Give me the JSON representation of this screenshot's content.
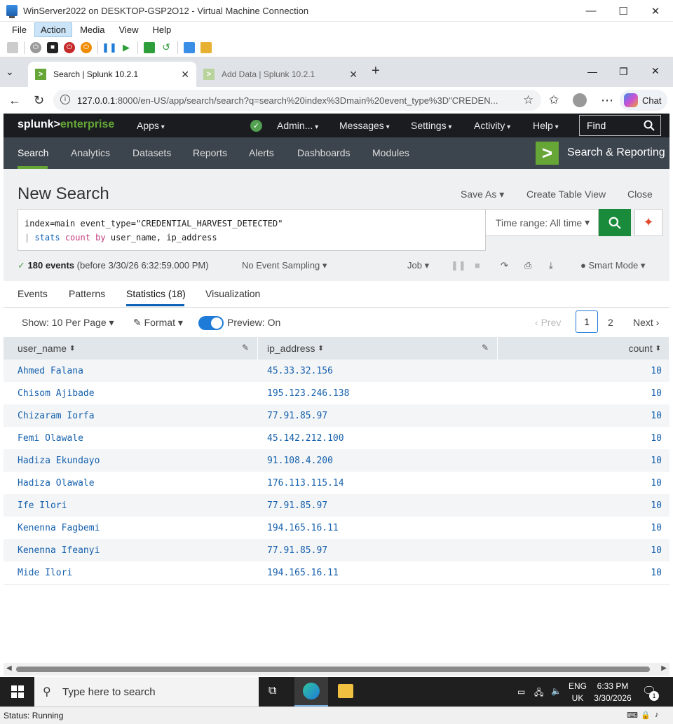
{
  "vm": {
    "title": "WinServer2022 on DESKTOP-GSP2O12 - Virtual Machine Connection",
    "menu": [
      "File",
      "Action",
      "Media",
      "View",
      "Help"
    ],
    "status": "Status: Running"
  },
  "browser": {
    "tabs": [
      {
        "label": "Search | Splunk 10.2.1",
        "active": true
      },
      {
        "label": "Add Data | Splunk 10.2.1",
        "active": false
      }
    ],
    "url_host": "127.0.0.1",
    "url_rest": ":8000/en-US/app/search/search?q=search%20index%3Dmain%20event_type%3D\"CREDEN...",
    "chat_label": "Chat"
  },
  "splunk": {
    "logo_a": "splunk>",
    "logo_b": "enterprise",
    "top_menu": {
      "apps": "Apps",
      "admin": "Admin...",
      "messages": "Messages",
      "settings": "Settings",
      "activity": "Activity",
      "help": "Help"
    },
    "find_placeholder": "Find",
    "nav": [
      "Search",
      "Analytics",
      "Datasets",
      "Reports",
      "Alerts",
      "Dashboards",
      "Modules"
    ],
    "app_name": "Search & Reporting"
  },
  "search": {
    "title": "New Search",
    "save_as": "Save As",
    "create_table_view": "Create Table View",
    "close": "Close",
    "query_line1": "index=main event_type=\"CREDENTIAL_HARVEST_DETECTED\"",
    "query_pipe": "| ",
    "query_cmd": "stats",
    "query_fn": "count",
    "query_by": "by",
    "query_fields": "user_name, ip_address",
    "time_range": "Time range: All time",
    "events_count": "180 events",
    "events_before": "(before 3/30/26 6:32:59.000 PM)",
    "sampling": "No Event Sampling",
    "job": "Job",
    "mode": "Smart Mode"
  },
  "result_tabs": [
    "Events",
    "Patterns",
    "Statistics (18)",
    "Visualization"
  ],
  "controls": {
    "show": "Show: 10 Per Page",
    "format": "Format",
    "preview": "Preview: On",
    "prev": "Prev",
    "page1": "1",
    "page2": "2",
    "next": "Next"
  },
  "table": {
    "columns": [
      "user_name",
      "ip_address",
      "count"
    ],
    "rows": [
      [
        "Ahmed Falana",
        "45.33.32.156",
        "10"
      ],
      [
        "Chisom Ajibade",
        "195.123.246.138",
        "10"
      ],
      [
        "Chizaram Iorfa",
        "77.91.85.97",
        "10"
      ],
      [
        "Femi Olawale",
        "45.142.212.100",
        "10"
      ],
      [
        "Hadiza Ekundayo",
        "91.108.4.200",
        "10"
      ],
      [
        "Hadiza Olawale",
        "176.113.115.14",
        "10"
      ],
      [
        "Ife Ilori",
        "77.91.85.97",
        "10"
      ],
      [
        "Kenenna Fagbemi",
        "194.165.16.11",
        "10"
      ],
      [
        "Kenenna Ifeanyi",
        "77.91.85.97",
        "10"
      ],
      [
        "Mide Ilori",
        "194.165.16.11",
        "10"
      ]
    ]
  },
  "taskbar": {
    "search_placeholder": "Type here to search",
    "lang1": "ENG",
    "lang2": "UK",
    "time": "6:33 PM",
    "date": "3/30/2026",
    "notif_count": "1"
  },
  "colors": {
    "splunk_green": "#65a637",
    "link_blue": "#1560ac",
    "nav_bg": "#3c444d"
  }
}
